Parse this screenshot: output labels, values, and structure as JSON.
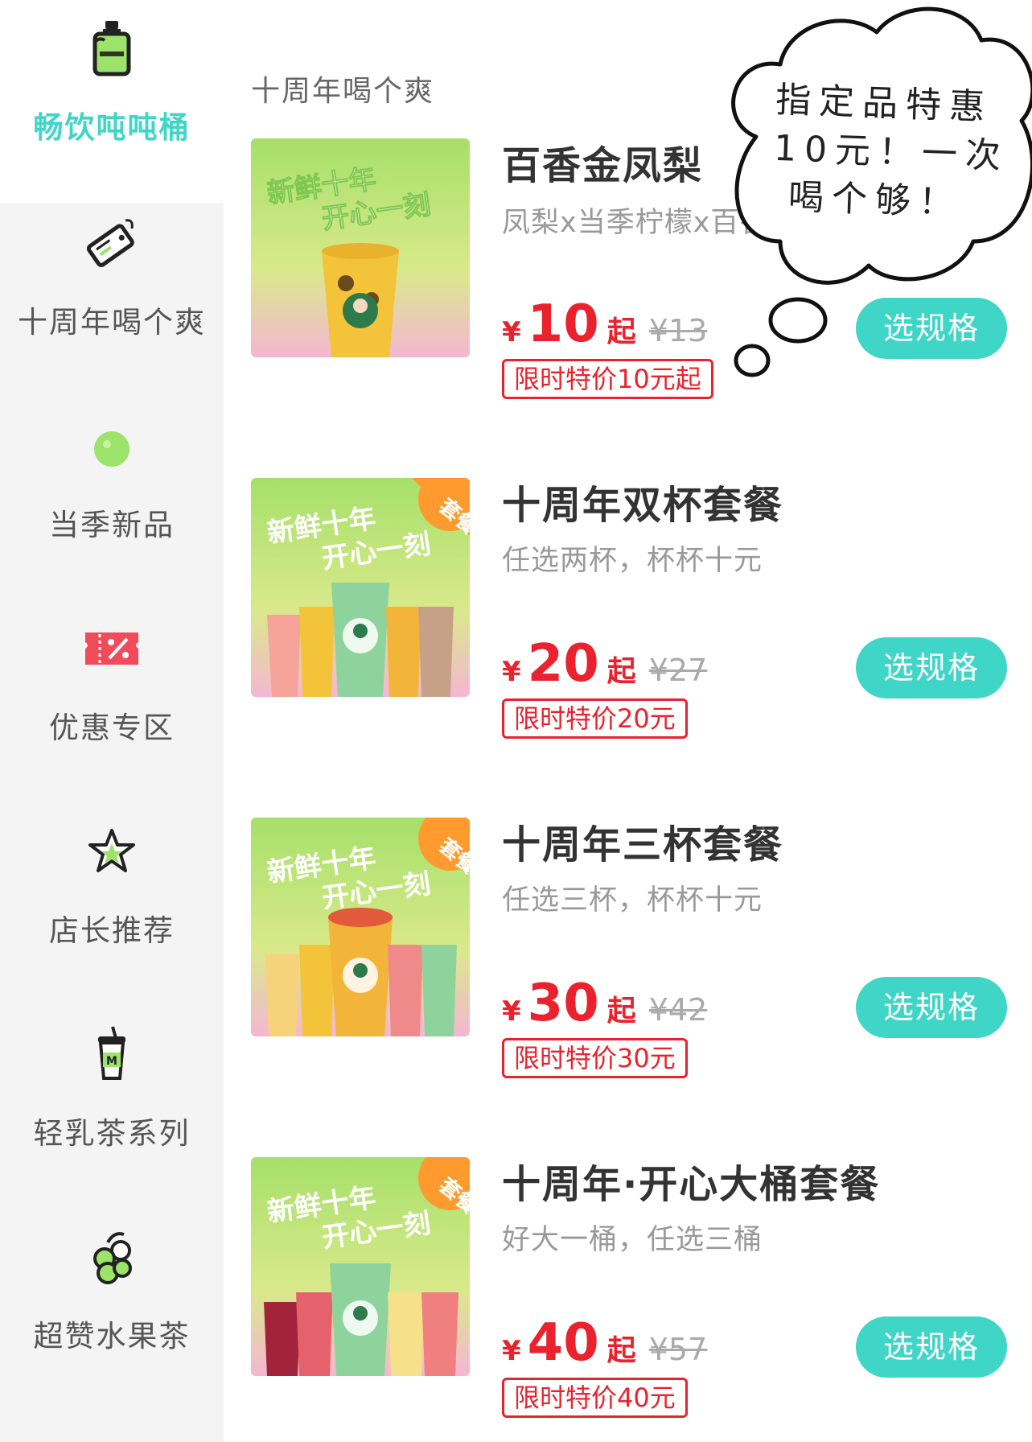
{
  "sidebar": {
    "items": [
      {
        "label": "畅饮吨吨桶",
        "icon": "water-bottle-icon",
        "active": true
      },
      {
        "label": "十周年喝个爽",
        "icon": "tag-icon",
        "active": false
      },
      {
        "label": "当季新品",
        "icon": "lime-icon",
        "active": false
      },
      {
        "label": "优惠专区",
        "icon": "coupon-icon",
        "active": false
      },
      {
        "label": "店长推荐",
        "icon": "star-icon",
        "active": false
      },
      {
        "label": "轻乳茶系列",
        "icon": "milk-tea-cup-icon",
        "active": false
      },
      {
        "label": "超赞水果茶",
        "icon": "fruit-icon",
        "active": false
      }
    ]
  },
  "main": {
    "section_title": "十周年喝个爽",
    "products": [
      {
        "name": "百香金凤梨",
        "desc": "凤梨x当季柠檬x百香",
        "currency": "¥",
        "price": "10",
        "suffix": "起",
        "original": "¥13",
        "promo": "限时特价10元起",
        "button": "选规格",
        "badge": ""
      },
      {
        "name": "十周年双杯套餐",
        "desc": "任选两杯，杯杯十元",
        "currency": "¥",
        "price": "20",
        "suffix": "起",
        "original": "¥27",
        "promo": "限时特价20元",
        "button": "选规格",
        "badge": "套餐"
      },
      {
        "name": "十周年三杯套餐",
        "desc": "任选三杯，杯杯十元",
        "currency": "¥",
        "price": "30",
        "suffix": "起",
        "original": "¥42",
        "promo": "限时特价30元",
        "button": "选规格",
        "badge": "套餐"
      },
      {
        "name": "十周年·开心大桶套餐",
        "desc": "好大一桶，任选三桶",
        "currency": "¥",
        "price": "40",
        "suffix": "起",
        "original": "¥57",
        "promo": "限时特价40元",
        "button": "选规格",
        "badge": "套餐"
      }
    ],
    "thumb_slogan_1": "新鲜十年",
    "thumb_slogan_2": "开心一刻"
  },
  "bubble": {
    "lines": [
      "指定品特惠",
      "10元！一次",
      "喝个够！"
    ]
  },
  "colors": {
    "accent": "#3fd6c8",
    "price_red": "#e9222d",
    "thumb_green": "#a6e06a",
    "thumb_pink": "#f5b6d3",
    "badge_orange": "#ff9a2e"
  }
}
